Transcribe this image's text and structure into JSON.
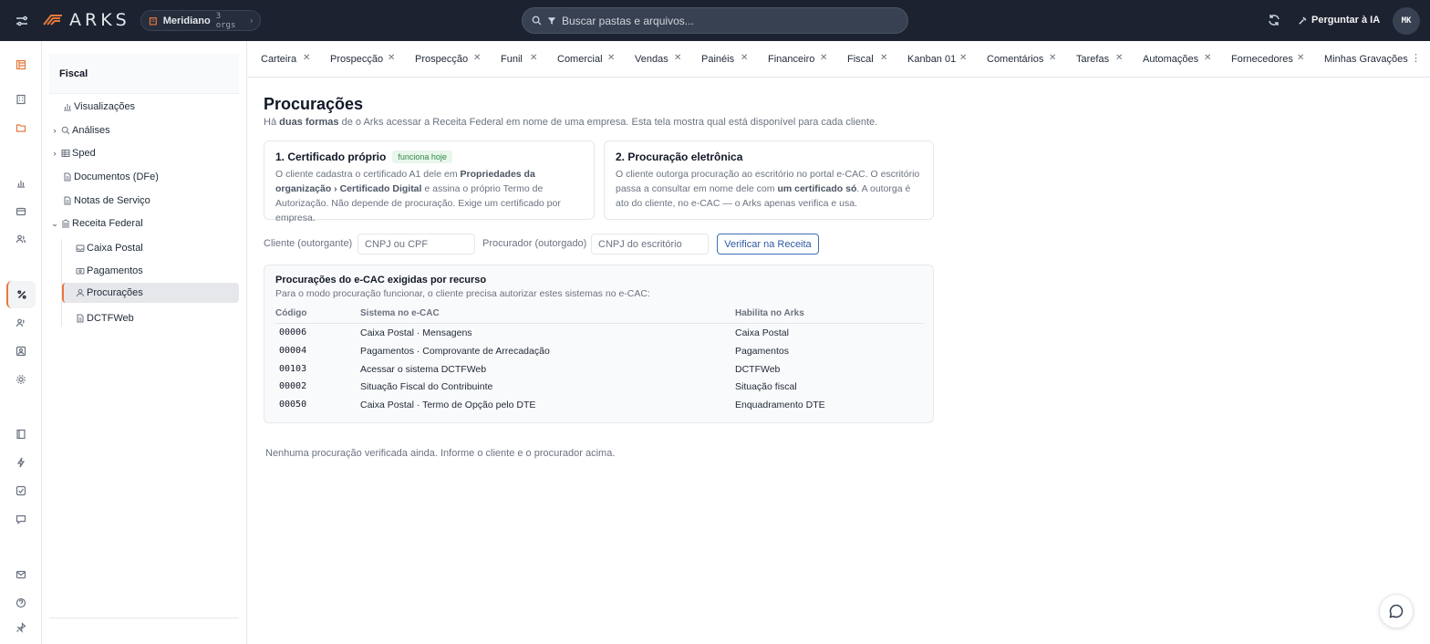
{
  "topbar": {
    "brand": "ARKS",
    "org_name": "Meridiano",
    "org_count": "3 orgs",
    "search_placeholder": "Buscar pastas e arquivos...",
    "ask_ai_label": "Perguntar à IA",
    "avatar_initials": "MK",
    "accent": "#e6783b"
  },
  "sidebar": {
    "title": "Fiscal",
    "items": [
      {
        "label": "Visualizações",
        "icon": "bar-chart-icon"
      },
      {
        "label": "Análises",
        "icon": "search-icon",
        "expandable": true
      },
      {
        "label": "Sped",
        "icon": "table-icon",
        "expandable": true
      },
      {
        "label": "Documentos (DFe)",
        "icon": "document-icon"
      },
      {
        "label": "Notas de Serviço",
        "icon": "document-icon"
      },
      {
        "label": "Receita Federal",
        "icon": "building-icon",
        "expanded": true
      }
    ],
    "children": [
      {
        "label": "Caixa Postal",
        "icon": "inbox-icon"
      },
      {
        "label": "Pagamentos",
        "icon": "payment-icon"
      },
      {
        "label": "Procurações",
        "icon": "user-icon",
        "selected": true
      },
      {
        "label": "DCTFWeb",
        "icon": "document-icon"
      }
    ]
  },
  "tabs": [
    "Carteira",
    "Prospecção",
    "Prospecção",
    "Funil",
    "Comercial",
    "Vendas",
    "Painéis",
    "Financeiro",
    "Fiscal",
    "Kanban 01",
    "Comentários",
    "Tarefas",
    "Automações",
    "Fornecedores",
    "Minhas Gravações"
  ],
  "page": {
    "title": "Procurações",
    "subtitle_pre": "Há ",
    "subtitle_bold": "duas formas",
    "subtitle_post": " de o Arks acessar a Receita Federal em nome de uma empresa. Esta tela mostra qual está disponível para cada cliente."
  },
  "cards": {
    "own": {
      "title": "1. Certificado próprio",
      "badge": "funciona hoje",
      "t1": "O cliente cadastra o certificado A1 dele em ",
      "b1": "Propriedades da organização › Certificado Digital",
      "t2": " e assina o próprio Termo de Autorização. Não depende de procuração. Exige um certificado por empresa."
    },
    "proxy": {
      "title": "2. Procuração eletrônica",
      "t1": "O cliente outorga procuração ao escritório no portal e-CAC. O escritório passa a consultar em nome dele com ",
      "b1": "um certificado só",
      "t2": ". A outorga é ato do cliente, no e-CAC — o Arks apenas verifica e usa."
    }
  },
  "filters": {
    "client_label": "Cliente (outorgante)",
    "client_placeholder": "CNPJ ou CPF",
    "proxy_label": "Procurador (outorgado)",
    "proxy_placeholder": "CNPJ do escritório",
    "verify_label": "Verificar na Receita"
  },
  "requirements": {
    "title": "Procurações do e-CAC exigidas por recurso",
    "subtitle": "Para o modo procuração funcionar, o cliente precisa autorizar estes sistemas no e-CAC:",
    "headers": [
      "Código",
      "Sistema no e-CAC",
      "Habilita no Arks"
    ],
    "rows": [
      [
        "00006",
        "Caixa Postal · Mensagens",
        "Caixa Postal"
      ],
      [
        "00004",
        "Pagamentos · Comprovante de Arrecadação",
        "Pagamentos"
      ],
      [
        "00103",
        "Acessar o sistema DCTFWeb",
        "DCTFWeb"
      ],
      [
        "00002",
        "Situação Fiscal do Contribuinte",
        "Situação fiscal"
      ],
      [
        "00050",
        "Caixa Postal · Termo de Opção pelo DTE",
        "Enquadramento DTE"
      ]
    ]
  },
  "empty_message": "Nenhuma procuração verificada ainda. Informe o cliente e o procurador acima."
}
